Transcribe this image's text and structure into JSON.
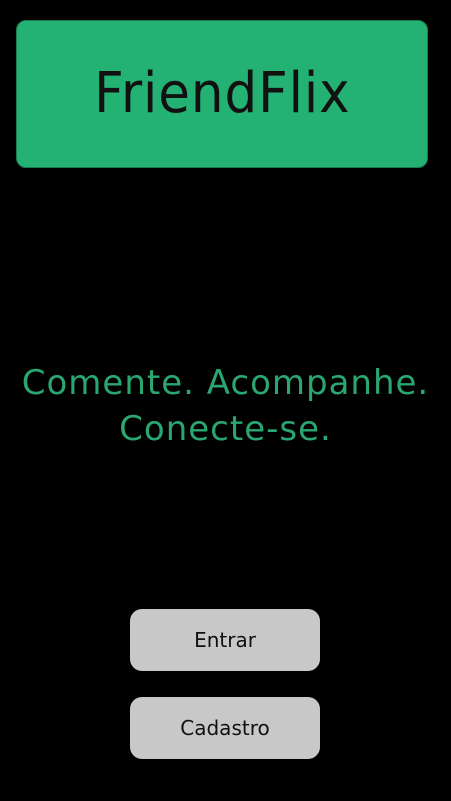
{
  "header": {
    "title": "FriendFlix"
  },
  "tagline": {
    "line1": "Comente. Acompanhe.",
    "line2": "Conecte-se."
  },
  "actions": {
    "login_label": "Entrar",
    "signup_label": "Cadastro"
  },
  "colors": {
    "brand_green": "#23b274",
    "tagline_green": "#2aa771",
    "background": "#000000",
    "button_gray": "#c8c8c8"
  }
}
